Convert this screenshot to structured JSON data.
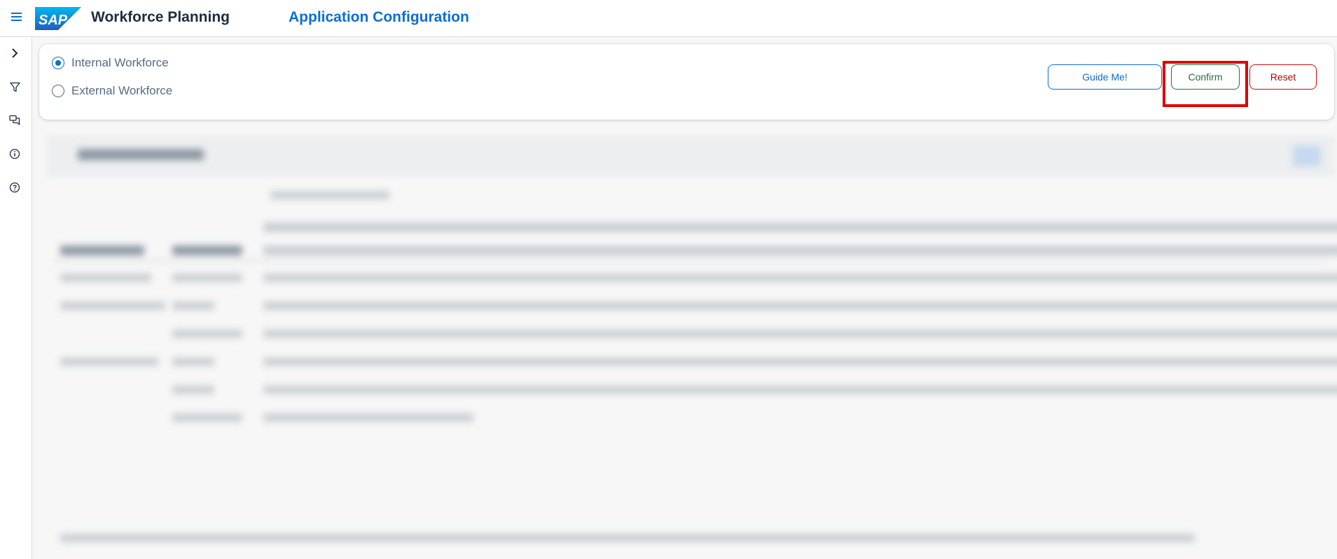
{
  "shell": {
    "menu_icon": "hamburger-icon",
    "logo_text": "SAP",
    "app_title": "Workforce Planning",
    "page_title": "Application Configuration"
  },
  "sidenav": {
    "items": [
      {
        "icon": "chevron-right-icon"
      },
      {
        "icon": "filter-icon"
      },
      {
        "icon": "comments-icon"
      },
      {
        "icon": "info-icon"
      },
      {
        "icon": "help-icon"
      }
    ]
  },
  "workforce": {
    "options": [
      {
        "label": "Internal Workforce",
        "selected": true
      },
      {
        "label": "External Workforce",
        "selected": false
      }
    ]
  },
  "actions": {
    "guide_label": "Guide Me!",
    "confirm_label": "Confirm",
    "reset_label": "Reset"
  },
  "colors": {
    "accent": "#0a6ed1",
    "confirm": "#256f3a",
    "reset": "#aa0808",
    "highlight": "#e00000"
  }
}
